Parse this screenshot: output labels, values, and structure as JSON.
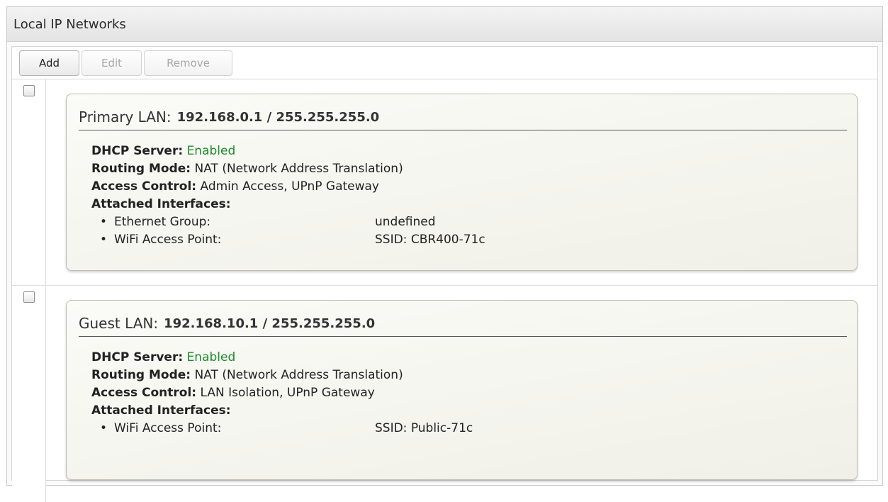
{
  "panel": {
    "title": "Local IP Networks"
  },
  "toolbar": {
    "add_label": "Add",
    "edit_label": "Edit",
    "remove_label": "Remove"
  },
  "networks": [
    {
      "name_label": "Primary LAN:",
      "address": "192.168.0.1 / 255.255.255.0",
      "dhcp_label": "DHCP Server:",
      "dhcp_value": "Enabled",
      "routing_label": "Routing Mode:",
      "routing_value": "NAT (Network Address Translation)",
      "access_label": "Access Control:",
      "access_value": "Admin Access, UPnP Gateway",
      "interfaces_label": "Attached Interfaces:",
      "interfaces": [
        {
          "name": "Ethernet Group:",
          "value": "undefined"
        },
        {
          "name": "WiFi Access Point:",
          "value": "SSID: CBR400-71c"
        }
      ]
    },
    {
      "name_label": "Guest LAN:",
      "address": "192.168.10.1 / 255.255.255.0",
      "dhcp_label": "DHCP Server:",
      "dhcp_value": "Enabled",
      "routing_label": "Routing Mode:",
      "routing_value": "NAT (Network Address Translation)",
      "access_label": "Access Control:",
      "access_value": "LAN Isolation, UPnP Gateway",
      "interfaces_label": "Attached Interfaces:",
      "interfaces": [
        {
          "name": "WiFi Access Point:",
          "value": "SSID: Public-71c"
        }
      ]
    }
  ],
  "colors": {
    "enabled": "#1c8a2a"
  }
}
